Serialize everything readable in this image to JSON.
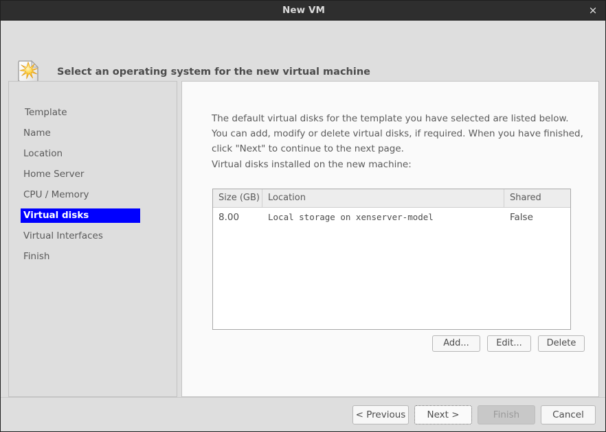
{
  "window": {
    "title": "New VM",
    "close_label": "×"
  },
  "header": {
    "icon": "new-document-star-icon",
    "title": "Select an operating system for the new virtual machine"
  },
  "sidebar": {
    "items": [
      {
        "label": "Template",
        "selected": false
      },
      {
        "label": "Name",
        "selected": false
      },
      {
        "label": "Location",
        "selected": false
      },
      {
        "label": "Home Server",
        "selected": false
      },
      {
        "label": "CPU / Memory",
        "selected": false
      },
      {
        "label": "Virtual disks",
        "selected": true
      },
      {
        "label": "Virtual Interfaces",
        "selected": false
      },
      {
        "label": "Finish",
        "selected": false
      }
    ],
    "selected_bg": "#0000ff",
    "selected_fg": "#ffffff"
  },
  "content": {
    "intro_lines": [
      "The default virtual disks for the template you have selected are listed below.",
      "You can add, modify or delete virtual disks, if required. When you have finished,",
      "click \"Next\" to continue to the next page."
    ],
    "sublabel": "Virtual disks installed on the new machine:",
    "table": {
      "columns": [
        "Size (GB)",
        "Location",
        "Shared"
      ],
      "rows": [
        [
          "8.00",
          "Local storage on xenserver-model",
          "False"
        ]
      ]
    },
    "actions": [
      {
        "label": "Add...",
        "enabled": true
      },
      {
        "label": "Edit...",
        "enabled": true
      },
      {
        "label": "Delete",
        "enabled": true
      }
    ]
  },
  "footer": {
    "buttons": [
      {
        "label": "< Previous",
        "enabled": true,
        "focused": false
      },
      {
        "label": "Next >",
        "enabled": true,
        "focused": true
      },
      {
        "label": "Finish",
        "enabled": false,
        "focused": false
      },
      {
        "label": "Cancel",
        "enabled": true,
        "focused": false
      }
    ]
  }
}
